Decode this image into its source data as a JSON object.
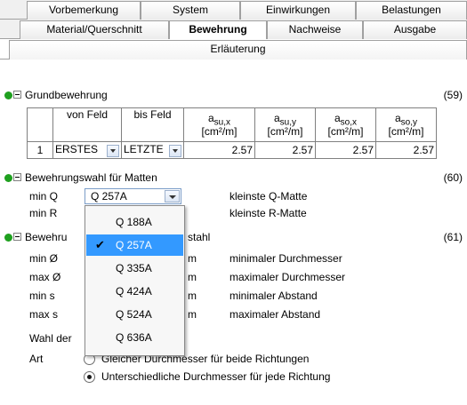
{
  "tabs": {
    "row1": [
      "Vorbemerkung",
      "System",
      "Einwirkungen",
      "Belastungen"
    ],
    "row2": [
      "Material/Querschnitt",
      "Bewehrung",
      "Nachweise",
      "Ausgabe"
    ],
    "row3": [
      "Erläuterung"
    ],
    "active": "Bewehrung"
  },
  "sections": {
    "grund": {
      "title": "Grundbewehrung",
      "num": "(59)"
    },
    "matten": {
      "title": "Bewehrungswahl für Matten",
      "num": "(60)"
    },
    "stahl": {
      "title_left": "Bewehru",
      "title_right": "stahl",
      "num": "(61)"
    }
  },
  "table": {
    "headers": [
      "von Feld",
      "bis Feld"
    ],
    "unit_headers": [
      {
        "sym": "a",
        "sub": "su,x",
        "unit": "[cm²/m]"
      },
      {
        "sym": "a",
        "sub": "su,y",
        "unit": "[cm²/m]"
      },
      {
        "sym": "a",
        "sub": "so,x",
        "unit": "[cm²/m]"
      },
      {
        "sym": "a",
        "sub": "so,y",
        "unit": "[cm²/m]"
      }
    ],
    "row": {
      "index": "1",
      "von": "ERSTES",
      "bis": "LETZTE",
      "values": [
        "2.57",
        "2.57",
        "2.57",
        "2.57"
      ]
    }
  },
  "matten": {
    "minq_label": "min Q",
    "minq_value": "Q 257A",
    "minq_desc": "kleinste Q-Matte",
    "minr_label": "min R",
    "minr_desc": "kleinste R-Matte"
  },
  "dropdown": {
    "options": [
      "Q 188A",
      "Q 257A",
      "Q 335A",
      "Q 424A",
      "Q 524A",
      "Q 636A"
    ],
    "selected": "Q 257A"
  },
  "stahl": {
    "rows": [
      {
        "label": "min Ø",
        "unit_tail": "m",
        "desc": "minimaler Durchmesser"
      },
      {
        "label": "max Ø",
        "unit_tail": "m",
        "desc": "maximaler Durchmesser"
      },
      {
        "label": "min s",
        "unit_tail": "m",
        "desc": "minimaler Abstand"
      },
      {
        "label": "max s",
        "unit_tail": "m",
        "desc": "maximaler Abstand"
      }
    ],
    "wahl_label": "Wahl der",
    "art_label": "Art",
    "radio1": "Gleicher Durchmesser für beide Richtungen",
    "radio2": "Unterschiedliche Durchmesser für jede Richtung"
  },
  "colors": {
    "dot": "#1fa01f",
    "selection": "#3399ff"
  }
}
